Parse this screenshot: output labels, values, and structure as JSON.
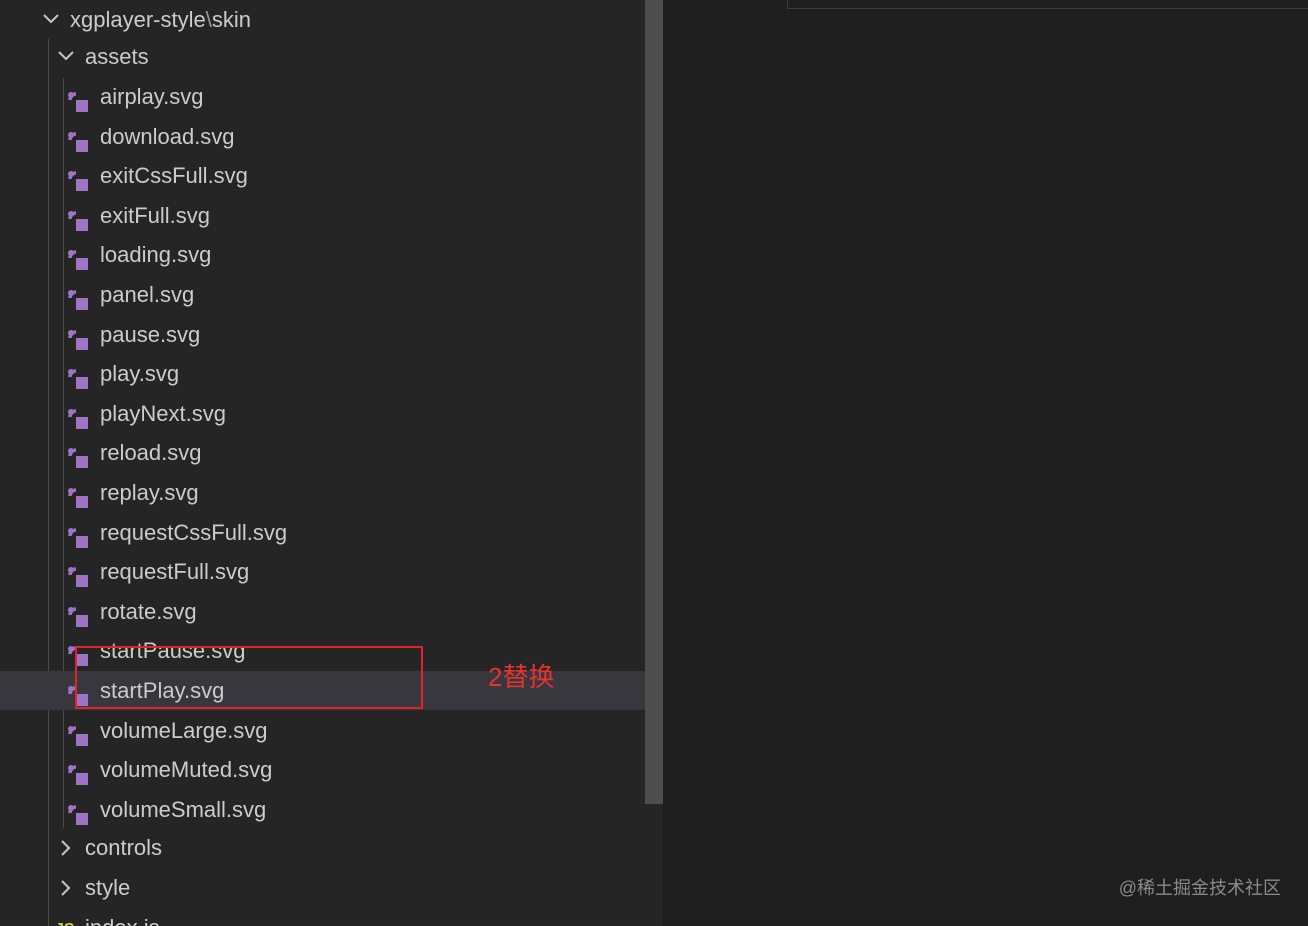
{
  "explorer": {
    "root": {
      "name": "xgplayer-style",
      "separator": "\\",
      "sub": "skin",
      "expanded": true
    },
    "assets_folder": {
      "name": "assets",
      "expanded": true
    },
    "files": [
      "airplay.svg",
      "download.svg",
      "exitCssFull.svg",
      "exitFull.svg",
      "loading.svg",
      "panel.svg",
      "pause.svg",
      "play.svg",
      "playNext.svg",
      "reload.svg",
      "replay.svg",
      "requestCssFull.svg",
      "requestFull.svg",
      "rotate.svg",
      "startPause.svg",
      "startPlay.svg",
      "volumeLarge.svg",
      "volumeMuted.svg",
      "volumeSmall.svg"
    ],
    "selected_file": "startPlay.svg",
    "collapsed_folders": [
      "controls",
      "style"
    ],
    "partial_file": {
      "badge": "JS",
      "name": "index.js"
    }
  },
  "annotation": {
    "text": "2替换",
    "color": "#e0242b"
  },
  "watermark": "@稀土掘金技术社区",
  "colors": {
    "sidebar_bg": "#252526",
    "editor_bg": "#1e1e1e",
    "selected_row": "#37373d",
    "svg_icon": "#a074c4",
    "text": "#cccccc"
  }
}
